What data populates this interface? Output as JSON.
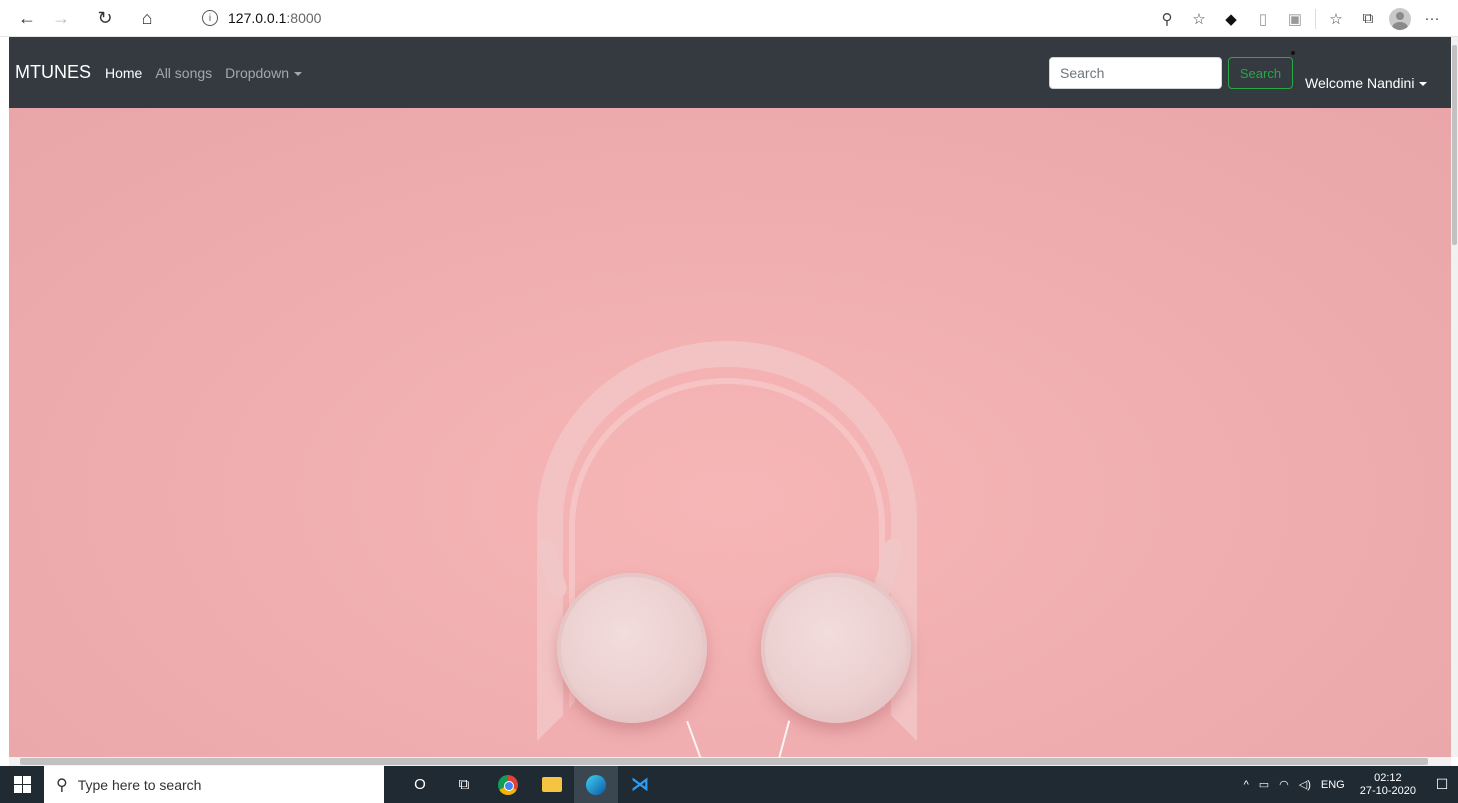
{
  "browser": {
    "url_host": "127.0.0.1",
    "url_port": ":8000",
    "back": "←",
    "forward": "→",
    "refresh": "↻",
    "home": "⌂",
    "info": "i",
    "zoom": "⚲",
    "favorite": "☆",
    "favorites_bar": "☆",
    "collections": "⧉",
    "more": "···"
  },
  "navbar": {
    "brand": "MTUNES",
    "links": [
      "Home",
      "All songs",
      "Dropdown"
    ],
    "search_placeholder": "Search",
    "search_button": "Search",
    "user_menu": "Welcome Nandini"
  },
  "taskbar": {
    "search_placeholder": "Type here to search",
    "cortana": "O",
    "task_view": "⧉",
    "tray_lang": "ENG",
    "time": "02:12",
    "date": "27-10-2020",
    "tray_chevron": "^",
    "notifications": "☐"
  }
}
